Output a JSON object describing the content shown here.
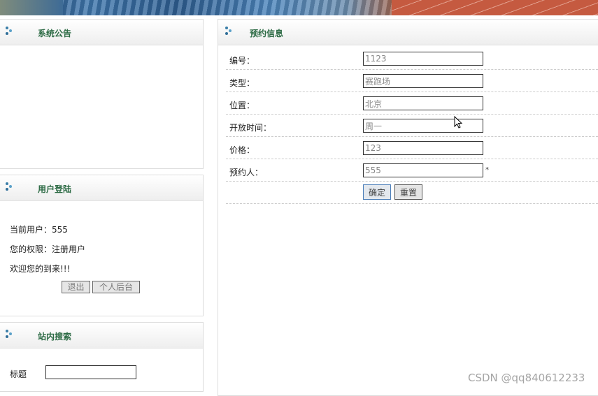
{
  "notice": {
    "title": "系统公告"
  },
  "login": {
    "title": "用户登陆",
    "current_user": "当前用户：555",
    "permission": "您的权限：注册用户",
    "welcome": "欢迎您的到来!!!",
    "logout_label": "退出",
    "backend_label": "个人后台"
  },
  "search": {
    "title": "站内搜索",
    "field_label": "标题",
    "value": ""
  },
  "booking": {
    "title": "预约信息",
    "fields": [
      {
        "label": "编号：",
        "value": "1123"
      },
      {
        "label": "类型：",
        "value": "赛跑场"
      },
      {
        "label": "位置：",
        "value": "北京"
      },
      {
        "label": "开放时间：",
        "value": "周一"
      },
      {
        "label": "价格：",
        "value": "123"
      },
      {
        "label": "预约人：",
        "value": "555",
        "required_mark": "*"
      }
    ],
    "submit_label": "确定",
    "reset_label": "重置"
  },
  "watermark": "CSDN @qq840612233"
}
